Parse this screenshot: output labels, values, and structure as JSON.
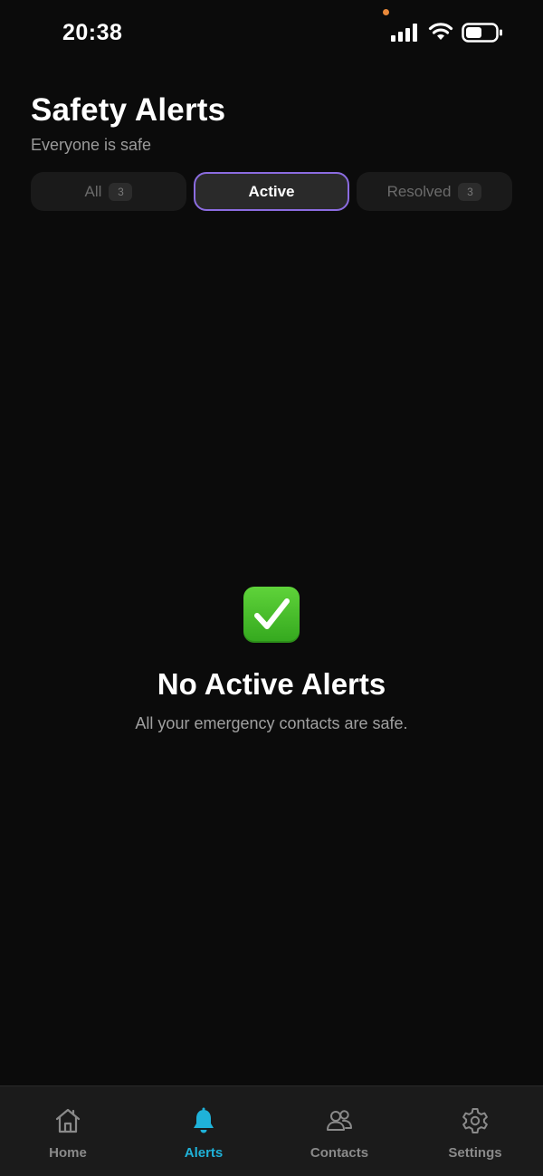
{
  "status_bar": {
    "time": "20:38"
  },
  "header": {
    "title": "Safety Alerts",
    "subtitle": "Everyone is safe"
  },
  "tabs": [
    {
      "label": "All",
      "count": "3"
    },
    {
      "label": "Active"
    },
    {
      "label": "Resolved",
      "count": "3"
    }
  ],
  "selected_tab": "Active",
  "empty_state": {
    "icon": "check-mark-icon",
    "title": "No Active Alerts",
    "description": "All your emergency contacts are safe."
  },
  "bottom_nav": {
    "items": [
      {
        "label": "Home",
        "icon": "home-icon"
      },
      {
        "label": "Alerts",
        "icon": "bell-icon"
      },
      {
        "label": "Contacts",
        "icon": "contacts-icon"
      },
      {
        "label": "Settings",
        "icon": "gear-icon"
      }
    ],
    "active": "Alerts"
  },
  "colors": {
    "background": "#0b0b0b",
    "accent_tab_border": "#8b6ce0",
    "nav_active": "#1fb2d9",
    "check_green": "#3fb82a"
  }
}
